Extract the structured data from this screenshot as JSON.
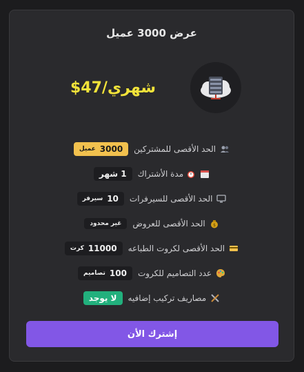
{
  "plan": {
    "title": "عرض 3000 عميل",
    "price": "$47/شهري",
    "logo_icon": "server-rack-cloud-icon"
  },
  "features": [
    {
      "icon": "users-icon",
      "label": "الحد الأقصى للمشتركين",
      "value": "3000",
      "unit": "عميل",
      "style": "gold"
    },
    {
      "icon": "calendar-alarm-icon",
      "label": "مدة الأشتراك",
      "value": "1 شهر",
      "unit": "",
      "style": "dark"
    },
    {
      "icon": "monitor-icon",
      "label": "الحد الأقصى للسيرفرات",
      "value": "10",
      "unit": "سيرفر",
      "style": "dark"
    },
    {
      "icon": "money-bag-icon",
      "label": "الحد الأقصى للعروض",
      "value": "غير محدود",
      "unit": "",
      "style": "dark-small"
    },
    {
      "icon": "card-icon",
      "label": "الحد الأقصى لكروت الطباعه",
      "value": "11000",
      "unit": "كرت",
      "style": "dark"
    },
    {
      "icon": "palette-icon",
      "label": "عدد التصاميم للكروت",
      "value": "100",
      "unit": "تصاميم",
      "style": "dark"
    },
    {
      "icon": "tools-icon",
      "label": "مصاريف تركيب إضافيه",
      "value": "لا يوجد",
      "unit": "",
      "style": "green"
    }
  ],
  "subscribe_label": "إشترك الأن",
  "colors": {
    "background": "#1c1c1e",
    "card": "#2a2a2d",
    "price": "#f2e33a",
    "button": "#8257e6",
    "gold_badge": "#f2c14e",
    "green_badge": "#22b07d"
  }
}
